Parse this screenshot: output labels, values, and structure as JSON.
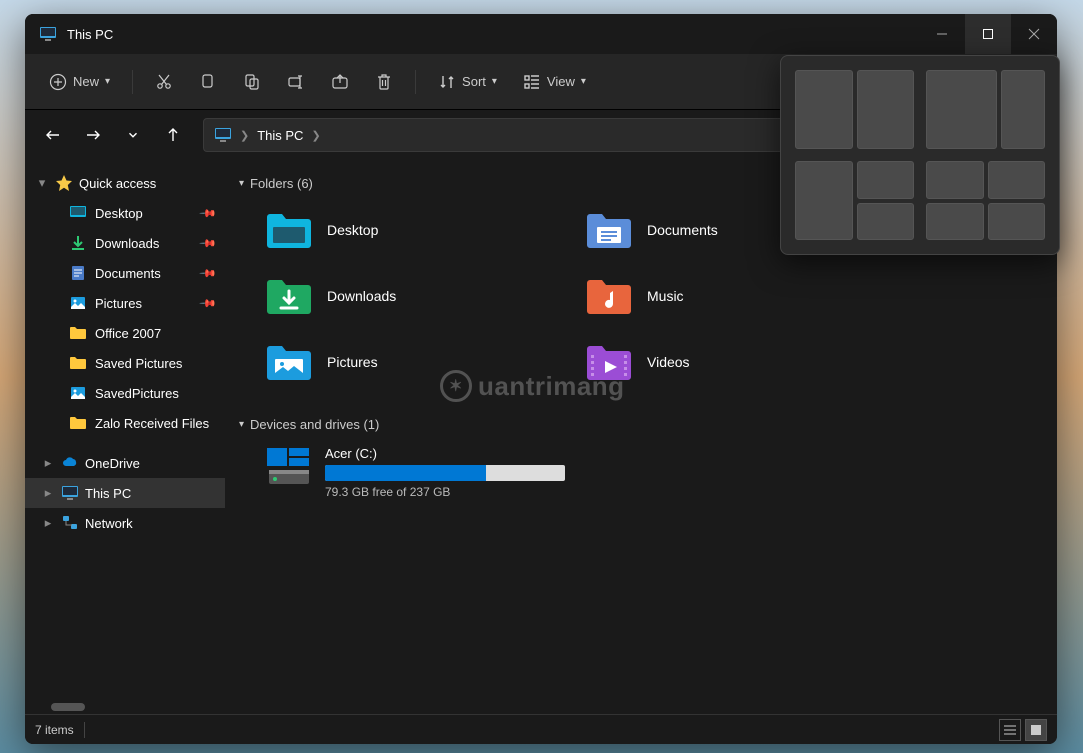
{
  "title": "This PC",
  "toolbar": {
    "new": "New",
    "sort": "Sort",
    "view": "View"
  },
  "address": {
    "location": "This PC"
  },
  "sidebar": {
    "quickAccess": {
      "label": "Quick access",
      "items": [
        {
          "label": "Desktop",
          "pinned": true
        },
        {
          "label": "Downloads",
          "pinned": true
        },
        {
          "label": "Documents",
          "pinned": true
        },
        {
          "label": "Pictures",
          "pinned": true
        },
        {
          "label": "Office 2007",
          "pinned": false
        },
        {
          "label": "Saved Pictures",
          "pinned": false
        },
        {
          "label": "SavedPictures",
          "pinned": false
        },
        {
          "label": "Zalo Received Files",
          "pinned": false
        }
      ]
    },
    "oneDrive": "OneDrive",
    "thisPC": "This PC",
    "network": "Network"
  },
  "groups": {
    "folders": {
      "title": "Folders (6)"
    },
    "drives": {
      "title": "Devices and drives (1)"
    }
  },
  "folders": [
    {
      "label": "Desktop",
      "icon": "desktop"
    },
    {
      "label": "Documents",
      "icon": "documents"
    },
    {
      "label": "Downloads",
      "icon": "downloads"
    },
    {
      "label": "Music",
      "icon": "music"
    },
    {
      "label": "Pictures",
      "icon": "pictures"
    },
    {
      "label": "Videos",
      "icon": "videos"
    }
  ],
  "drive": {
    "name": "Acer (C:)",
    "free": "79.3 GB free of 237 GB",
    "percent": 67
  },
  "status": {
    "items": "7 items"
  },
  "watermark": "uantrimang"
}
